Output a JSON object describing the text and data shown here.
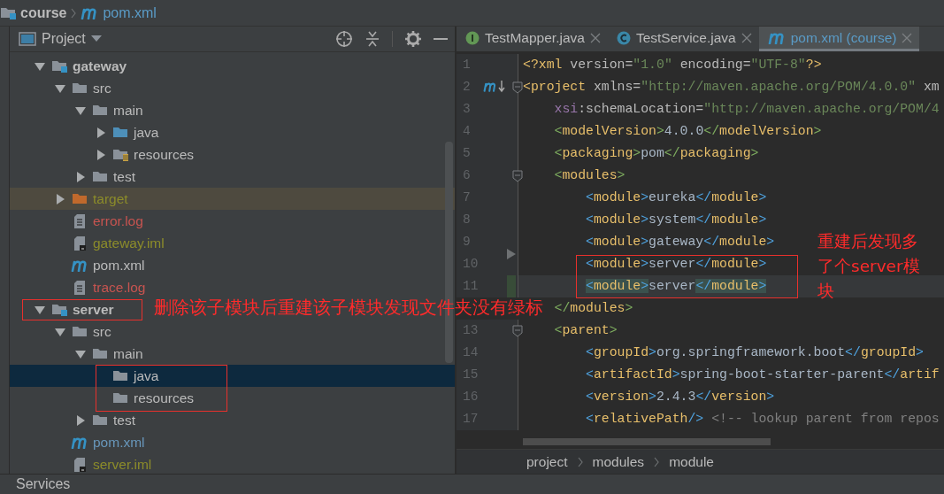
{
  "navigation_bar": {
    "items": [
      {
        "kind": "module",
        "label": "course"
      },
      {
        "kind": "pom",
        "label": "pom.xml"
      }
    ]
  },
  "project_panel": {
    "title": "Project",
    "tree": [
      {
        "kind": "module",
        "label": "gateway",
        "color": "#bbbbbb",
        "expanded": true,
        "selected": false,
        "children": [
          {
            "kind": "folder",
            "label": "src",
            "color": "#bbbbbb",
            "expanded": true,
            "selected": false,
            "children": [
              {
                "kind": "folder",
                "label": "main",
                "color": "#bbbbbb",
                "expanded": true,
                "selected": false,
                "children": [
                  {
                    "kind": "source-folder",
                    "label": "java",
                    "color": "#bbbbbb",
                    "expanded": false,
                    "selected": false
                  },
                  {
                    "kind": "resource-folder",
                    "label": "resources",
                    "color": "#bbbbbb",
                    "expanded": false,
                    "selected": false
                  }
                ]
              },
              {
                "kind": "folder",
                "label": "test",
                "color": "#bbbbbb",
                "expanded": false,
                "selected": false
              }
            ]
          },
          {
            "kind": "excluded-folder",
            "label": "target",
            "color": "#8c8c2a",
            "expanded": false,
            "selected": false
          },
          {
            "kind": "log",
            "label": "error.log",
            "color": "#c75450",
            "selected": false
          },
          {
            "kind": "iml",
            "label": "gateway.iml",
            "color": "#8c8c2a",
            "selected": false
          },
          {
            "kind": "pom",
            "label": "pom.xml",
            "color": "#bbbbbb",
            "selected": false
          },
          {
            "kind": "log",
            "label": "trace.log",
            "color": "#c75450",
            "selected": false
          }
        ]
      },
      {
        "kind": "module",
        "label": "server",
        "color": "#bbbbbb",
        "expanded": true,
        "selected": false,
        "children": [
          {
            "kind": "folder",
            "label": "src",
            "color": "#bbbbbb",
            "expanded": true,
            "selected": false,
            "children": [
              {
                "kind": "folder",
                "label": "main",
                "color": "#bbbbbb",
                "expanded": true,
                "selected": false,
                "children": [
                  {
                    "kind": "folder",
                    "label": "java",
                    "color": "#bbbbbb",
                    "selected": true
                  },
                  {
                    "kind": "folder",
                    "label": "resources",
                    "color": "#bbbbbb",
                    "selected": false
                  }
                ]
              },
              {
                "kind": "folder",
                "label": "test",
                "color": "#bbbbbb",
                "expanded": false,
                "selected": false
              }
            ]
          },
          {
            "kind": "pom",
            "label": "pom.xml",
            "color": "#6897bb",
            "selected": false
          },
          {
            "kind": "iml",
            "label": "server.iml",
            "color": "#8c8c2a",
            "selected": false
          }
        ]
      }
    ]
  },
  "editor": {
    "tabs": [
      {
        "kind": "interface",
        "label": "TestMapper.java",
        "selected": false
      },
      {
        "kind": "class",
        "label": "TestService.java",
        "selected": false
      },
      {
        "kind": "pom",
        "label": "pom.xml (course)",
        "selected": true
      }
    ],
    "lines": [
      {
        "kind": "plain",
        "number": "1",
        "text": "<?xml version=\"1.0\" encoding=\"UTF-8\"?>",
        "current": false,
        "changed": false
      },
      {
        "kind": "maven-fold-start",
        "number": "2",
        "text": "<project xmlns=\"http://maven.apache.org/POM/4.0.0\" xm",
        "current": false,
        "changed": false
      },
      {
        "kind": "plain",
        "number": "3",
        "text": "    xsi:schemaLocation=\"http://maven.apache.org/POM/4",
        "current": false,
        "changed": false
      },
      {
        "kind": "plain",
        "number": "4",
        "text": "    <modelVersion>4.0.0</modelVersion>",
        "current": false,
        "changed": false
      },
      {
        "kind": "plain",
        "number": "5",
        "text": "    <packaging>pom</packaging>",
        "current": false,
        "changed": false
      },
      {
        "kind": "fold-start",
        "number": "6",
        "text": "    <modules>",
        "current": false,
        "changed": false
      },
      {
        "kind": "plain",
        "number": "7",
        "text": "        <module>eureka</module>",
        "current": false,
        "changed": false
      },
      {
        "kind": "plain",
        "number": "8",
        "text": "        <module>system</module>",
        "current": false,
        "changed": false
      },
      {
        "kind": "plain",
        "number": "9",
        "text": "        <module>gateway</module>",
        "current": false,
        "changed": false
      },
      {
        "kind": "folded",
        "number": "10",
        "text": "        <module>server</module>",
        "current": false,
        "changed": false
      },
      {
        "kind": "plain",
        "number": "11",
        "text": "        <module>server</module>",
        "current": true,
        "changed": true
      },
      {
        "kind": "plain",
        "text": "    </modules>",
        "current": false,
        "changed": false
      },
      {
        "kind": "fold-start",
        "number": "13",
        "text": "    <parent>",
        "current": false,
        "changed": false
      },
      {
        "kind": "plain",
        "number": "14",
        "text": "        <groupId>org.springframework.boot</groupId>",
        "current": false,
        "changed": false
      },
      {
        "kind": "plain",
        "number": "15",
        "text": "        <artifactId>spring-boot-starter-parent</artif",
        "current": false,
        "changed": false
      },
      {
        "kind": "plain",
        "number": "16",
        "text": "        <version>2.4.3</version>",
        "current": false,
        "changed": false
      },
      {
        "kind": "plain",
        "number": "17",
        "text": "        <relativePath/> <!-- lookup parent from repos",
        "current": false,
        "changed": false
      }
    ],
    "breadcrumbs": [
      "project",
      "modules",
      "module"
    ]
  },
  "bottom_bar": {
    "label": "Services"
  },
  "annotations": [
    {
      "text": "删除该子模块后重建该子模块发现文件夹没有绿标"
    },
    {
      "text": "重建后发现多了个server模块"
    }
  ]
}
